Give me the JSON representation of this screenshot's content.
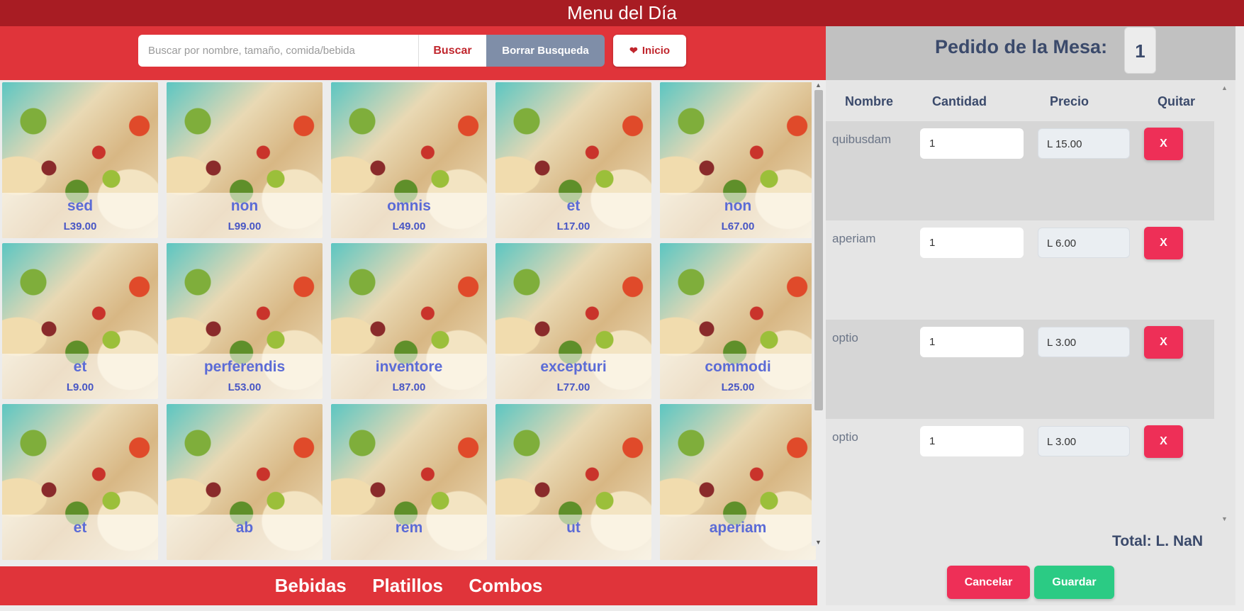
{
  "header": {
    "title": "Menu del Día"
  },
  "search": {
    "placeholder": "Buscar por nombre, tamaño, comida/bebida",
    "search_label": "Buscar",
    "clear_label": "Borrar Busqueda",
    "home_label": "Inicio",
    "home_icon": "heart-icon"
  },
  "menu_items": [
    {
      "name": "sed",
      "price": "L39.00"
    },
    {
      "name": "non",
      "price": "L99.00"
    },
    {
      "name": "omnis",
      "price": "L49.00"
    },
    {
      "name": "et",
      "price": "L17.00"
    },
    {
      "name": "non",
      "price": "L67.00"
    },
    {
      "name": "et",
      "price": "L9.00"
    },
    {
      "name": "perferendis",
      "price": "L53.00"
    },
    {
      "name": "inventore",
      "price": "L87.00"
    },
    {
      "name": "excepturi",
      "price": "L77.00"
    },
    {
      "name": "commodi",
      "price": "L25.00"
    },
    {
      "name": "et",
      "price": ""
    },
    {
      "name": "ab",
      "price": ""
    },
    {
      "name": "rem",
      "price": ""
    },
    {
      "name": "ut",
      "price": ""
    },
    {
      "name": "aperiam",
      "price": ""
    }
  ],
  "categories": [
    "Bebidas",
    "Platillos",
    "Combos"
  ],
  "order": {
    "title": "Pedido de la Mesa:",
    "table_number": "1",
    "columns": [
      "Nombre",
      "Cantidad",
      "Precio",
      "Quitar"
    ],
    "rows": [
      {
        "name": "quibusdam",
        "qty": "1",
        "price": "L 15.00",
        "remove": "X"
      },
      {
        "name": "aperiam",
        "qty": "1",
        "price": "L 6.00",
        "remove": "X"
      },
      {
        "name": "optio",
        "qty": "1",
        "price": "L 3.00",
        "remove": "X"
      },
      {
        "name": "optio",
        "qty": "1",
        "price": "L 3.00",
        "remove": "X"
      }
    ],
    "total": "Total: L. NaN",
    "cancel_label": "Cancelar",
    "save_label": "Guardar"
  },
  "colors": {
    "topbar": "#a81c23",
    "accent_red": "#e0343a",
    "danger": "#ee2f57",
    "success": "#2bcb84",
    "card_text": "#5b6bd6"
  }
}
